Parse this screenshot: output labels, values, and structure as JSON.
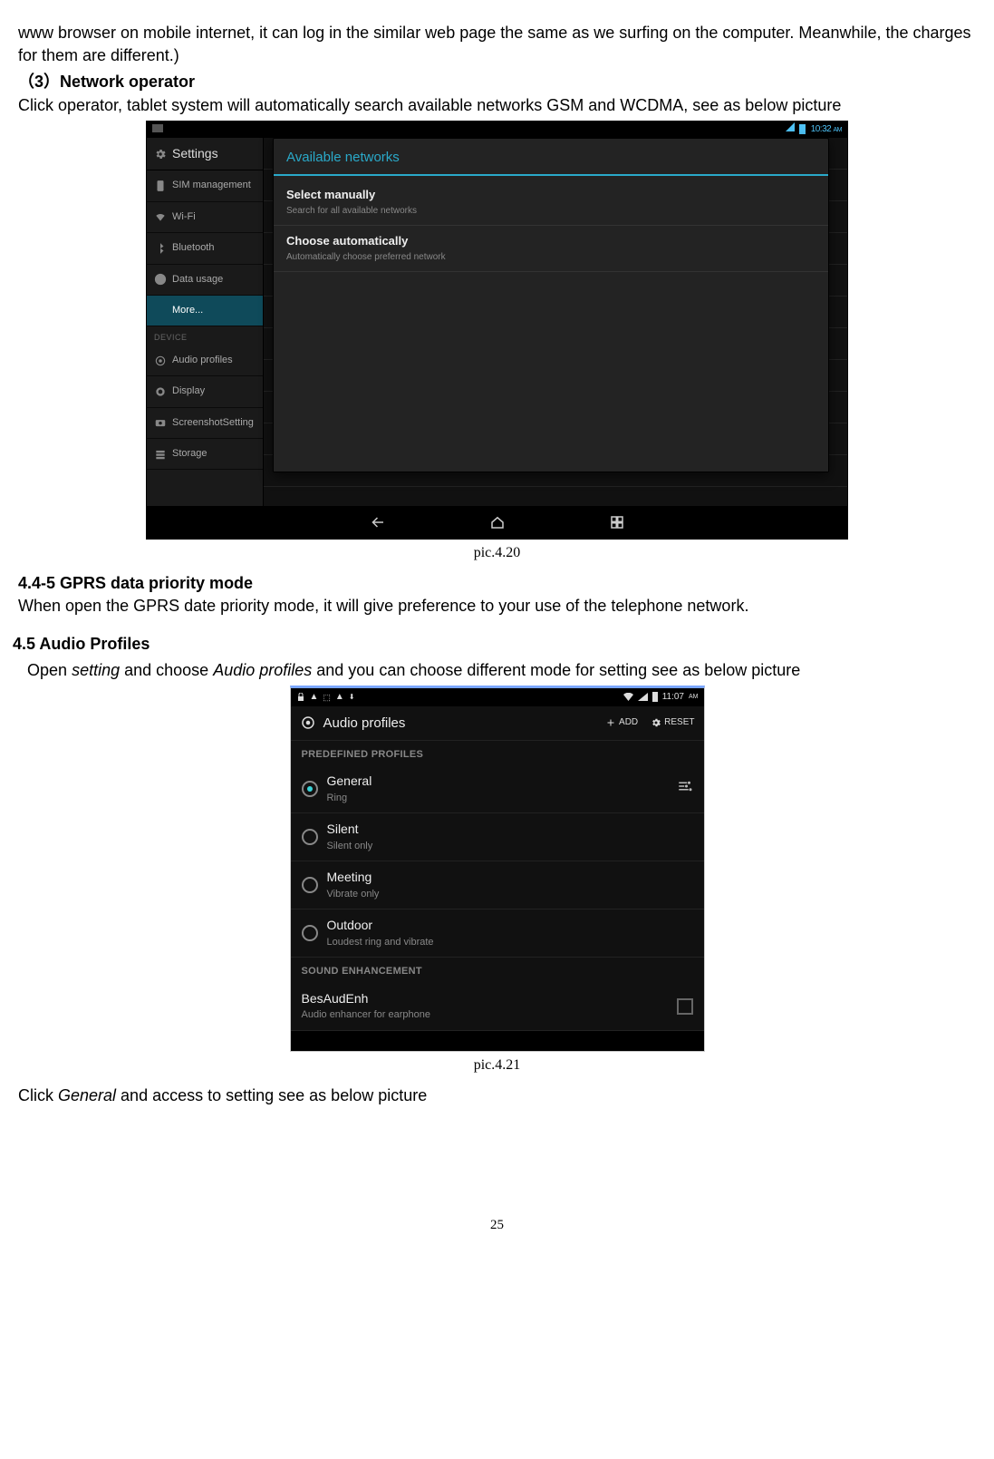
{
  "intro_paragraph": "www browser on mobile internet, it can log in the similar web page the same as we surfing on the computer. Meanwhile, the charges for them are different.)",
  "section3_heading": "（3）Network operator",
  "section3_body": "Click operator, tablet system will automatically search available networks GSM and WCDMA, see as below picture",
  "caption1": "pic.4.20",
  "gprs_heading": "4.4-5 GPRS data priority mode",
  "gprs_body": "When open the GPRS date priority mode, it will give preference to your use of the telephone network.",
  "audio_heading": "4.5 Audio Profiles",
  "audio_body_pre": "Open ",
  "audio_body_em1": "setting",
  "audio_body_mid1": " and choose ",
  "audio_body_em2": "Audio profiles",
  "audio_body_post": " and you can choose different mode for setting see as below picture",
  "caption2": "pic.4.21",
  "final_pre": "Click ",
  "final_em": "General",
  "final_post": " and access to setting see as below picture",
  "page_number": "25",
  "shot1": {
    "status_time": "10:32",
    "status_ampm": "AM",
    "side_title": "Settings",
    "side_items": [
      {
        "label": "SIM management",
        "icon": "sim"
      },
      {
        "label": "Wi-Fi",
        "icon": "wifi"
      },
      {
        "label": "Bluetooth",
        "icon": "bt"
      },
      {
        "label": "Data usage",
        "icon": "data"
      },
      {
        "label": "More...",
        "icon": "",
        "selected": true
      }
    ],
    "side_section": "DEVICE",
    "side_items2": [
      {
        "label": "Audio profiles",
        "icon": "audio"
      },
      {
        "label": "Display",
        "icon": "display"
      },
      {
        "label": "ScreenshotSetting",
        "icon": "shot"
      },
      {
        "label": "Storage",
        "icon": "storage"
      }
    ],
    "dialog_title": "Available networks",
    "dialog_items": [
      {
        "title": "Select manually",
        "sub": "Search for all available networks"
      },
      {
        "title": "Choose automatically",
        "sub": "Automatically choose preferred network"
      }
    ]
  },
  "shot2": {
    "status_time": "11:07",
    "status_ampm": "AM",
    "header_title": "Audio profiles",
    "action_add": "ADD",
    "action_reset": "RESET",
    "section1": "PREDEFINED PROFILES",
    "profiles": [
      {
        "title": "General",
        "sub": "Ring",
        "selected": true,
        "settings": true
      },
      {
        "title": "Silent",
        "sub": "Silent only",
        "selected": false
      },
      {
        "title": "Meeting",
        "sub": "Vibrate only",
        "selected": false
      },
      {
        "title": "Outdoor",
        "sub": "Loudest ring and vibrate",
        "selected": false
      }
    ],
    "section2": "SOUND ENHANCEMENT",
    "enhance": {
      "title": "BesAudEnh",
      "sub": "Audio enhancer for earphone"
    }
  }
}
